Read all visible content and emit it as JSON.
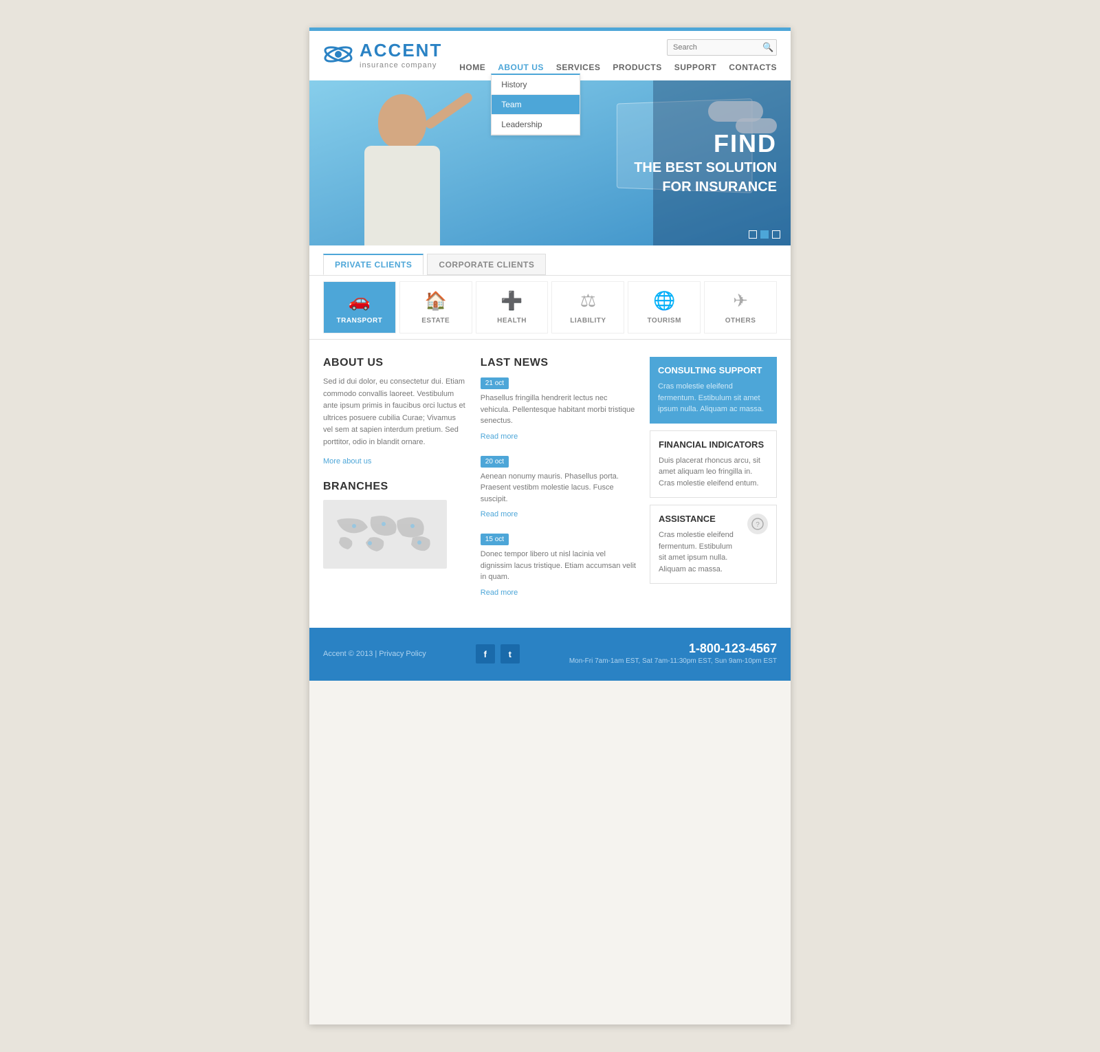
{
  "topbar": {},
  "header": {
    "logo_accent": "ACCENT",
    "logo_subtitle": "insurance company",
    "search_placeholder": "Search"
  },
  "nav": {
    "items": [
      {
        "label": "HOME",
        "active": false
      },
      {
        "label": "ABOUT US",
        "active": true
      },
      {
        "label": "SERVICES",
        "active": false
      },
      {
        "label": "PRODUCTS",
        "active": false
      },
      {
        "label": "SUPPORT",
        "active": false
      },
      {
        "label": "CONTACTS",
        "active": false
      }
    ],
    "dropdown": {
      "items": [
        {
          "label": "History",
          "active": false
        },
        {
          "label": "Team",
          "active": true
        },
        {
          "label": "Leadership",
          "active": false
        }
      ]
    }
  },
  "hero": {
    "line1": "FIND",
    "line2": "THE BEST SOLUTION",
    "line3": "FOR INSURANCE"
  },
  "tabs": {
    "items": [
      {
        "label": "PRIVATE CLIENTS",
        "active": true
      },
      {
        "label": "CORPORATE CLIENTS",
        "active": false
      }
    ]
  },
  "services": [
    {
      "label": "TRANSPORT",
      "icon": "🚗",
      "active": true
    },
    {
      "label": "ESTATE",
      "icon": "🏠",
      "active": false
    },
    {
      "label": "HEALTH",
      "icon": "➕",
      "active": false
    },
    {
      "label": "LIABILITY",
      "icon": "⚖",
      "active": false
    },
    {
      "label": "TOURISM",
      "icon": "🌐",
      "active": false
    },
    {
      "label": "OTHERS",
      "icon": "✈",
      "active": false
    }
  ],
  "about": {
    "title": "ABOUT US",
    "text": "Sed id dui dolor, eu consectetur dui. Etiam commodo convallis laoreet. Vestibulum ante ipsum primis in faucibus orci luctus et ultrices posuere cubilia Curae; Vivamus vel sem at sapien interdum pretium. Sed porttitor, odio in blandit ornare.",
    "more_link": "More about us"
  },
  "branches": {
    "title": "BRANCHES"
  },
  "news": {
    "title": "LAST NEWS",
    "items": [
      {
        "date": "21 oct",
        "text": "Phasellus fringilla hendrerit lectus nec vehicula. Pellentesque habitant morbi tristique senectus.",
        "read_more": "Read more"
      },
      {
        "date": "20 oct",
        "text": "Aenean nonumy mauris. Phasellus porta. Praesent vestibm molestie lacus. Fusce suscipit.",
        "read_more": "Read more"
      },
      {
        "date": "15 oct",
        "text": "Donec tempor libero ut nisl lacinia vel dignissim lacus tristique. Etiam accumsan velit in quam.",
        "read_more": "Read more"
      }
    ]
  },
  "consulting": {
    "title": "CONSULTING SUPPORT",
    "text": "Cras molestie eleifend fermentum. Estibulum sit amet ipsum nulla. Aliquam ac massa."
  },
  "financial": {
    "title": "FINANCIAL INDICATORS",
    "text": "Duis placerat rhoncus arcu, sit amet aliquam leo fringilla in. Cras molestie eleifend entum."
  },
  "assistance": {
    "title": "ASSISTANCE",
    "text": "Cras molestie eleifend fermentum. Estibulum sit amet ipsum nulla.  Aliquam ac massa."
  },
  "footer": {
    "copyright": "Accent © 2013 | Privacy Policy",
    "phone": "1-800-123-4567",
    "hours": "Mon-Fri 7am-1am EST, Sat 7am-11:30pm EST,\nSun 9am-10pm EST",
    "facebook_icon": "f",
    "twitter_icon": "t"
  }
}
